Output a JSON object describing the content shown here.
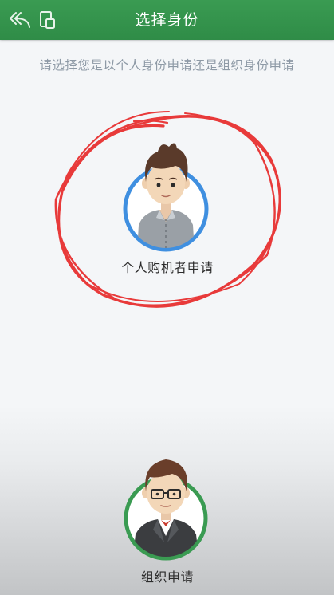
{
  "header": {
    "title": "选择身份",
    "back_icon": "back-arrow-icon",
    "window_icon": "window-icon"
  },
  "subtitle": "请选择您是以个人身份申请还是组织身份申请",
  "options": [
    {
      "label": "个人购机者申请",
      "avatar_icon": "individual-avatar-icon",
      "ring_color": "#3f8fe0"
    },
    {
      "label": "组织申请",
      "avatar_icon": "organization-avatar-icon",
      "ring_color": "#3a9b52"
    }
  ],
  "colors": {
    "header": "#36964f",
    "annotation": "#e83a3a"
  }
}
